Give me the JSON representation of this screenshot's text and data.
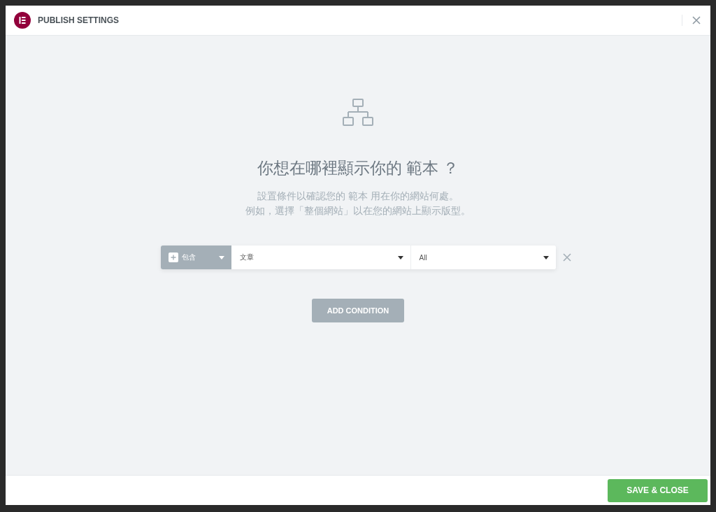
{
  "header": {
    "title": "PUBLISH SETTINGS"
  },
  "heading": "你想在哪裡顯示你的 範本 ？",
  "description": [
    "設置條件以確認您的 範本 用在你的網站何處。",
    "例如，選擇「整個網站」以在您的網站上顯示版型。"
  ],
  "conditions": [
    {
      "type": "包含",
      "name": "文章",
      "sub_name": "All"
    }
  ],
  "add_button": "ADD CONDITION",
  "save_button": "SAVE & CLOSE"
}
